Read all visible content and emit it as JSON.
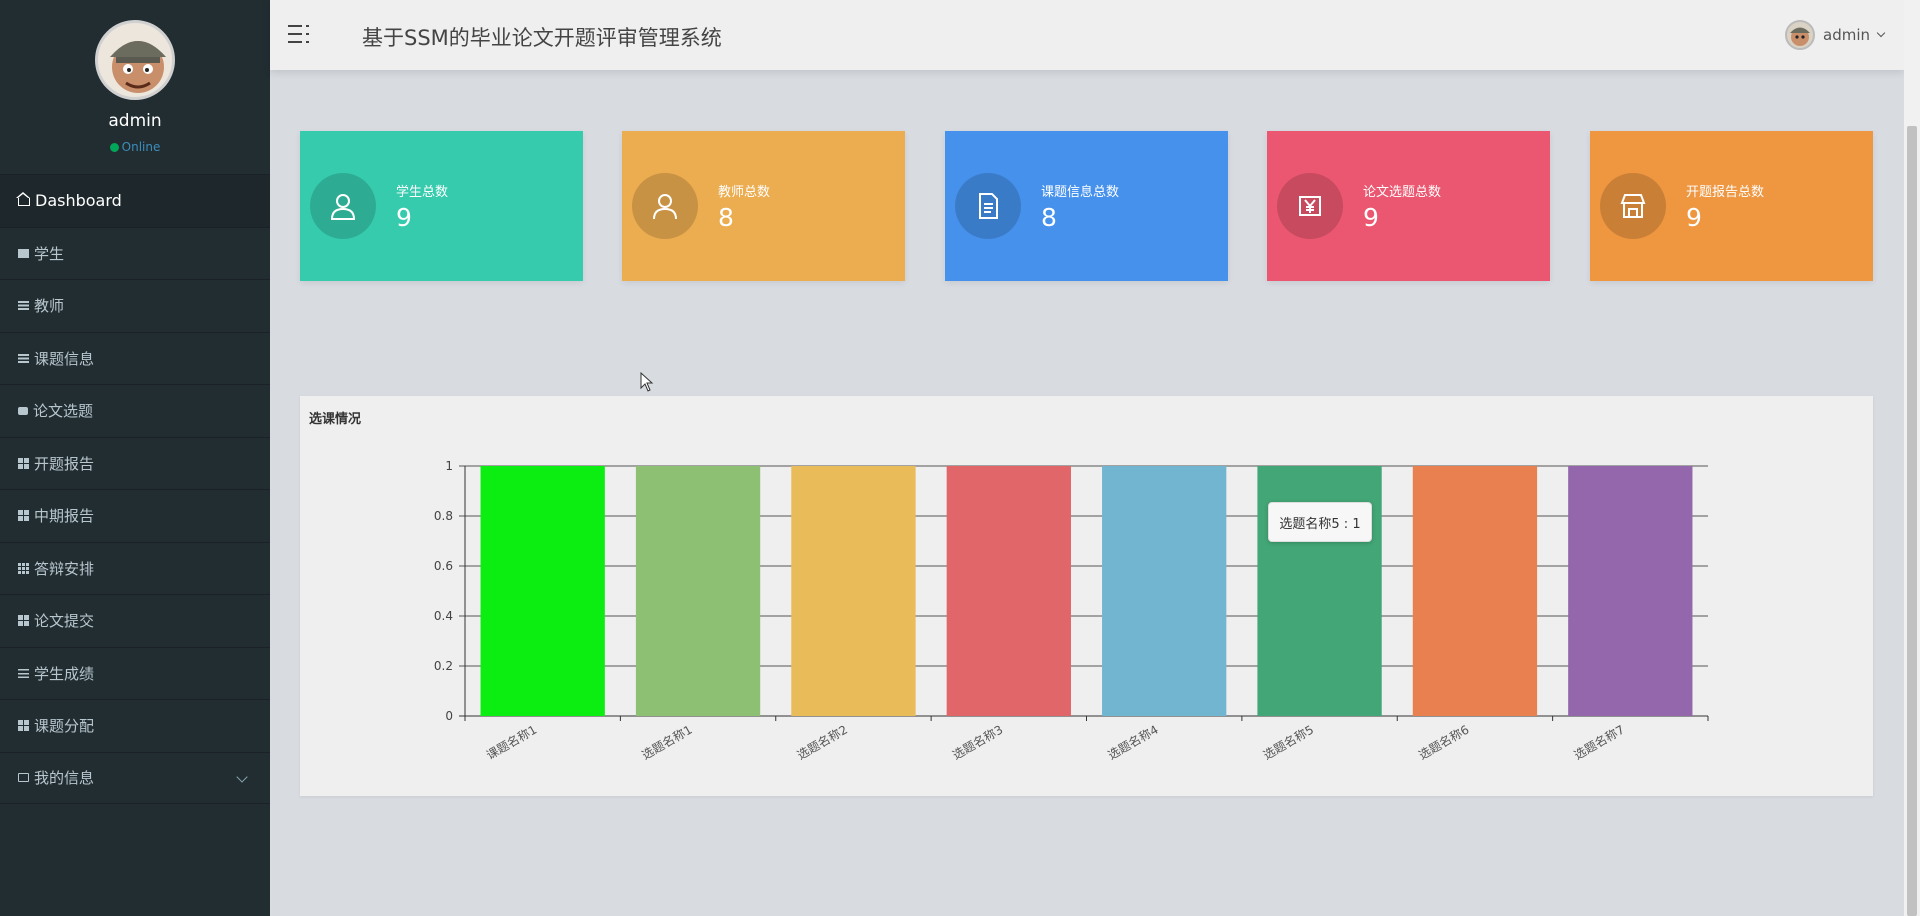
{
  "sidebar": {
    "user": {
      "name": "admin",
      "status": "Online"
    },
    "items": [
      {
        "label": "Dashboard",
        "icon": "home-icon"
      },
      {
        "label": "学生",
        "icon": "chart-icon"
      },
      {
        "label": "教师",
        "icon": "list-icon"
      },
      {
        "label": "课题信息",
        "icon": "list-icon"
      },
      {
        "label": "论文选题",
        "icon": "comment-icon"
      },
      {
        "label": "开题报告",
        "icon": "grid-icon"
      },
      {
        "label": "中期报告",
        "icon": "grid-icon"
      },
      {
        "label": "答辩安排",
        "icon": "grid9-icon"
      },
      {
        "label": "论文提交",
        "icon": "grid-icon"
      },
      {
        "label": "学生成绩",
        "icon": "sliders-icon"
      },
      {
        "label": "课题分配",
        "icon": "grid-icon"
      },
      {
        "label": "我的信息",
        "icon": "card-icon"
      }
    ]
  },
  "header": {
    "title": "基于SSM的毕业论文开题评审管理系统",
    "user": "admin"
  },
  "stats": [
    {
      "label": "学生总数",
      "value": "9",
      "color": "#36cbad",
      "icon": "user-icon"
    },
    {
      "label": "教师总数",
      "value": "8",
      "color": "#ecac50",
      "icon": "user-icon"
    },
    {
      "label": "课题信息总数",
      "value": "8",
      "color": "#4591ec",
      "icon": "document-icon"
    },
    {
      "label": "论文选题总数",
      "value": "9",
      "color": "#eb5770",
      "icon": "yen-icon"
    },
    {
      "label": "开题报告总数",
      "value": "9",
      "color": "#ee9640",
      "icon": "store-icon"
    }
  ],
  "chart": {
    "title": "选课情况",
    "tooltip": "选题名称5 : 1"
  },
  "chart_data": {
    "type": "bar",
    "title": "选课情况",
    "categories": [
      "课题名称1",
      "选题名称1",
      "选题名称2",
      "选题名称3",
      "选题名称4",
      "选题名称5",
      "选题名称6",
      "选题名称7"
    ],
    "values": [
      1,
      1,
      1,
      1,
      1,
      1,
      1,
      1
    ],
    "colors": [
      "#0ced12",
      "#8dc073",
      "#e9bb59",
      "#e06669",
      "#71b5d0",
      "#43a676",
      "#e9804f",
      "#9466ac"
    ],
    "yticks": [
      "0",
      "0.2",
      "0.4",
      "0.6",
      "0.8",
      "1"
    ],
    "ylim": [
      0,
      1
    ],
    "grid": true
  }
}
